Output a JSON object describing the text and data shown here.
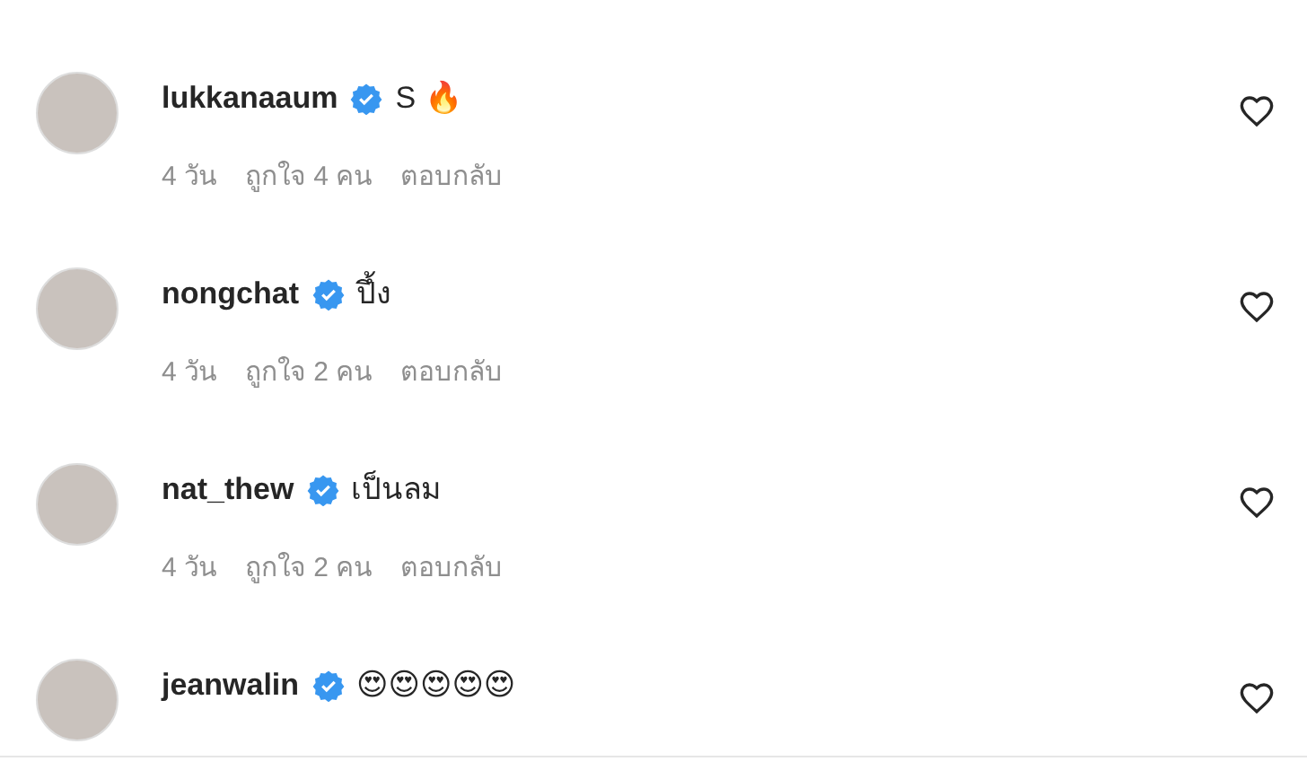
{
  "comments": [
    {
      "username": "lukkanaaum",
      "verified": true,
      "text": "S 🔥",
      "time": "4 วัน",
      "likes": "ถูกใจ 4 คน",
      "reply": "ตอบกลับ",
      "liked": false
    },
    {
      "username": "nongchat",
      "verified": true,
      "text": "ปึ้ง",
      "time": "4 วัน",
      "likes": "ถูกใจ 2 คน",
      "reply": "ตอบกลับ",
      "liked": false
    },
    {
      "username": "nat_thew",
      "verified": true,
      "text": "เป็นลม",
      "time": "4 วัน",
      "likes": "ถูกใจ 2 คน",
      "reply": "ตอบกลับ",
      "liked": false
    },
    {
      "username": "jeanwalin",
      "verified": true,
      "text": "😍😍😍😍😍",
      "liked": false
    }
  ]
}
